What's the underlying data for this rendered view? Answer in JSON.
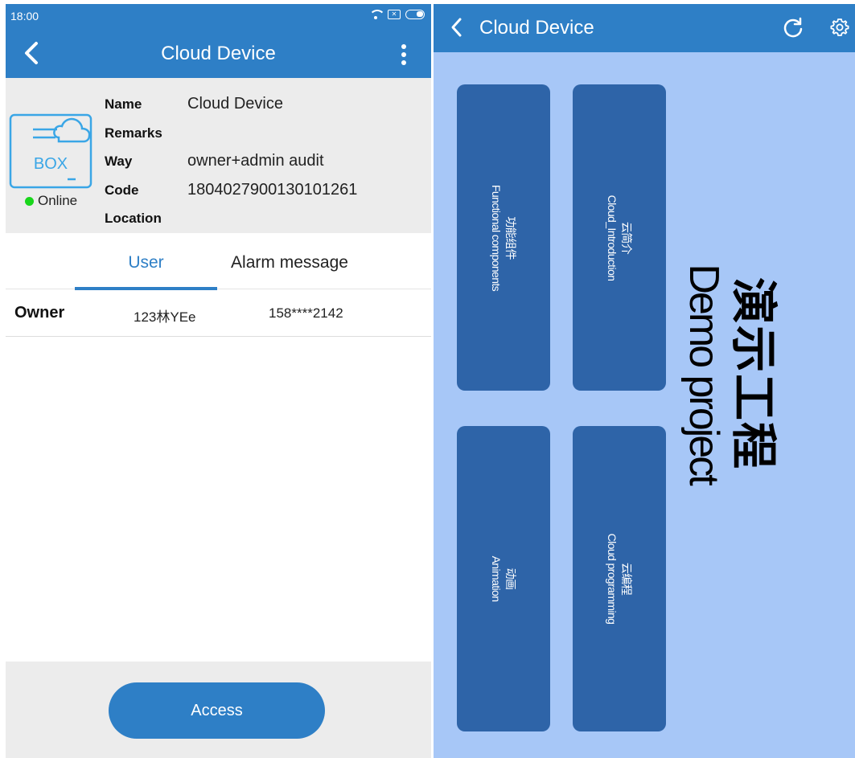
{
  "left": {
    "status_bar": {
      "time": "18:00"
    },
    "app_bar": {
      "title": "Cloud Device"
    },
    "device": {
      "icon_text": "BOX",
      "status": "Online",
      "labels": [
        "Name",
        "Remarks",
        "Way",
        "Code",
        "Location"
      ],
      "values": {
        "name": "Cloud Device",
        "remarks": "",
        "way": "owner+admin audit",
        "code": "1804027900130101261",
        "location": ""
      }
    },
    "tabs": {
      "user": "User",
      "alarm": "Alarm message",
      "active": "user"
    },
    "users": [
      {
        "role": "Owner",
        "name": "123林YEe",
        "phone": "158****2142"
      }
    ],
    "access_button": "Access"
  },
  "right": {
    "app_bar": {
      "title": "Cloud Device"
    },
    "tiles": [
      {
        "cn": "功能组件",
        "en": "Functional components"
      },
      {
        "cn": "云简介",
        "en": "Cloud_Introduction"
      },
      {
        "cn": "动画",
        "en": "Animation"
      },
      {
        "cn": "云编程",
        "en": "Cloud programming"
      }
    ],
    "project": {
      "cn": "演示工程",
      "en": "Demo project"
    }
  },
  "colors": {
    "primary": "#2e7fc6",
    "tile": "#2e64a8",
    "canvas": "#a7c7f7",
    "online": "#19d61b",
    "panel_gray": "#ececec"
  },
  "icons": [
    "back-arrow-icon",
    "more-vertical-icon",
    "wifi-icon",
    "sim-icon",
    "battery-icon",
    "box-cloud-icon",
    "refresh-icon",
    "gear-icon"
  ]
}
